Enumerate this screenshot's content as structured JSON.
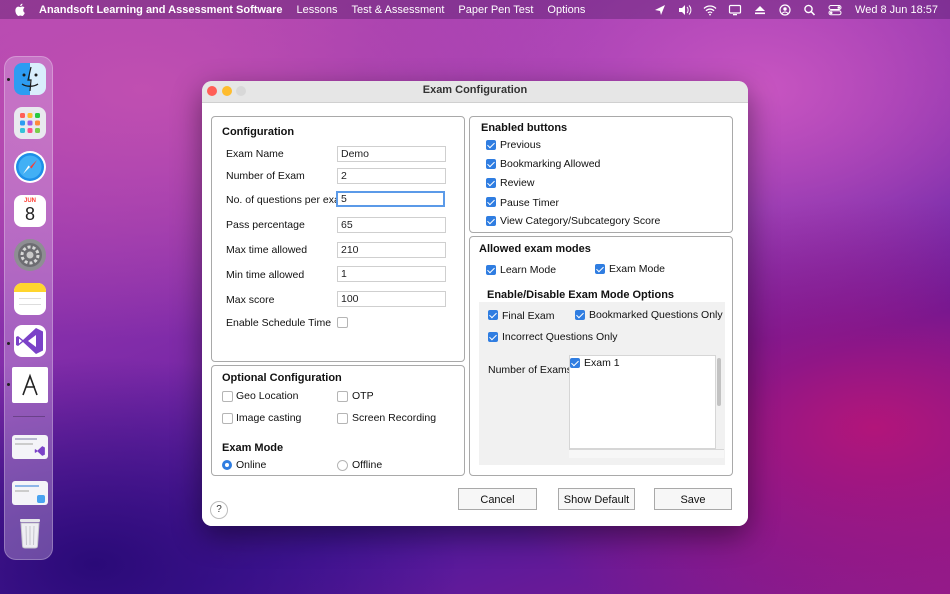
{
  "menubar": {
    "app_name": "Anandsoft Learning and Assessment Software",
    "menus": [
      "Lessons",
      "Test & Assessment",
      "Paper Pen Test",
      "Options"
    ],
    "clock": "Wed 8 Jun  18:57",
    "status_icons": [
      "location-icon",
      "volume-icon",
      "wifi-icon",
      "display-icon",
      "eject-icon",
      "user-icon",
      "search-icon",
      "control-center-icon"
    ]
  },
  "dock": {
    "apps": [
      "finder",
      "launchpad",
      "safari",
      "calendar",
      "system-preferences",
      "notes",
      "visual-studio",
      "anandsoft",
      "recent-window-1",
      "recent-window-2",
      "trash"
    ],
    "calendar": {
      "month": "JUN",
      "day": "8"
    }
  },
  "window": {
    "title": "Exam Configuration",
    "configuration": {
      "title": "Configuration",
      "fields": [
        {
          "label": "Exam Name",
          "value": "Demo"
        },
        {
          "label": "Number of Exam",
          "value": "2"
        },
        {
          "label": "No. of questions per exam",
          "value": "5"
        },
        {
          "label": "Pass percentage",
          "value": "65"
        },
        {
          "label": "Max time allowed",
          "value": "210"
        },
        {
          "label": "Min time allowed",
          "value": "1"
        },
        {
          "label": "Max score",
          "value": "100"
        }
      ],
      "schedule_label": "Enable Schedule Time",
      "schedule_checked": false
    },
    "optional": {
      "title": "Optional Configuration",
      "geo_location": "Geo Location",
      "otp": "OTP",
      "image_casting": "Image casting",
      "screen_recording": "Screen Recording",
      "exam_mode_title": "Exam Mode",
      "online": "Online",
      "offline": "Offline",
      "selected_mode": "Online"
    },
    "enabled_buttons": {
      "title": "Enabled buttons",
      "items": [
        "Previous",
        "Bookmarking Allowed",
        "Review",
        "Pause Timer",
        "View Category/Subcategory Score"
      ]
    },
    "allowed_modes": {
      "title": "Allowed exam modes",
      "learn_mode": "Learn Mode",
      "exam_mode": "Exam Mode",
      "options_title": "Enable/Disable Exam Mode Options",
      "final_exam": "Final Exam",
      "bookmarked_only": "Bookmarked Questions Only",
      "incorrect_only": "Incorrect Questions Only",
      "number_of_exams_label": "Number of Exams",
      "exam_list": [
        "Exam 1"
      ]
    },
    "buttons": {
      "help": "?",
      "cancel": "Cancel",
      "show_default": "Show Default",
      "save": "Save"
    },
    "colors": {
      "accent": "#2f7de1",
      "focus_ring": "#5b9ae8"
    }
  }
}
